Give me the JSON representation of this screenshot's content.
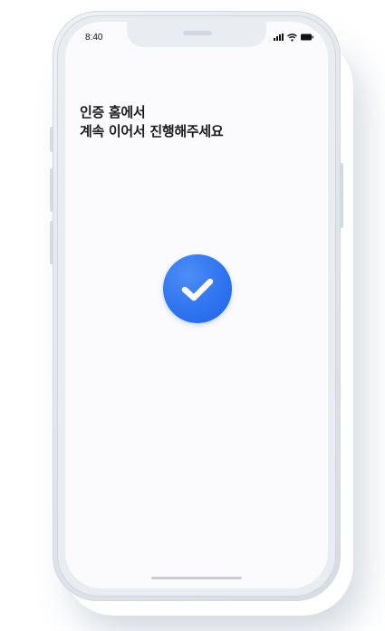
{
  "status_bar": {
    "time": "8:40",
    "icons": [
      "signal-icon",
      "wifi-icon",
      "battery-icon"
    ]
  },
  "main": {
    "headline_line1": "인증 홈에서",
    "headline_line2": "계속 이어서 진행해주세요",
    "status_icon": "checkmark-icon"
  },
  "colors": {
    "accent": "#2f74f0",
    "text": "#1b1b1f",
    "screen_background": "#fbfbfe"
  }
}
